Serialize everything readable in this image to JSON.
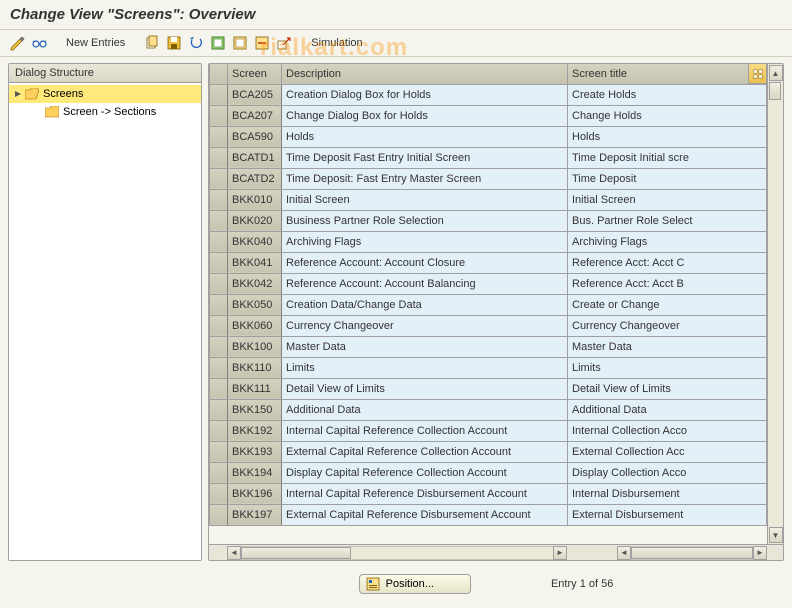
{
  "title": "Change View \"Screens\": Overview",
  "watermark": "rialkart.com",
  "toolbar": {
    "new_entries": "New Entries",
    "simulation": "Simulation"
  },
  "tree": {
    "header": "Dialog Structure",
    "items": [
      {
        "label": "Screens",
        "level": 0,
        "open": true,
        "selected": true
      },
      {
        "label": "Screen -> Sections",
        "level": 1,
        "open": false,
        "closed": true
      }
    ]
  },
  "table": {
    "headers": {
      "screen": "Screen",
      "description": "Description",
      "title": "Screen title"
    },
    "rows": [
      {
        "screen": "BCA205",
        "description": "Creation Dialog Box for Holds",
        "title": "Create Holds"
      },
      {
        "screen": "BCA207",
        "description": "Change Dialog Box for Holds",
        "title": "Change Holds"
      },
      {
        "screen": "BCA590",
        "description": "Holds",
        "title": "Holds"
      },
      {
        "screen": "BCATD1",
        "description": "Time Deposit Fast Entry Initial Screen",
        "title": "Time Deposit Initial scre"
      },
      {
        "screen": "BCATD2",
        "description": "Time Deposit: Fast Entry Master Screen",
        "title": "Time Deposit"
      },
      {
        "screen": "BKK010",
        "description": "Initial Screen",
        "title": "Initial Screen"
      },
      {
        "screen": "BKK020",
        "description": "Business Partner Role Selection",
        "title": "Bus. Partner Role Select"
      },
      {
        "screen": "BKK040",
        "description": "Archiving Flags",
        "title": "Archiving Flags"
      },
      {
        "screen": "BKK041",
        "description": "Reference Account: Account Closure",
        "title": "Reference Acct: Acct C"
      },
      {
        "screen": "BKK042",
        "description": "Reference Account: Account Balancing",
        "title": "Reference Acct: Acct B"
      },
      {
        "screen": "BKK050",
        "description": "Creation Data/Change Data",
        "title": "Create or Change"
      },
      {
        "screen": "BKK060",
        "description": "Currency Changeover",
        "title": "Currency Changeover"
      },
      {
        "screen": "BKK100",
        "description": "Master Data",
        "title": "Master Data"
      },
      {
        "screen": "BKK110",
        "description": "Limits",
        "title": "Limits"
      },
      {
        "screen": "BKK111",
        "description": "Detail View of Limits",
        "title": "Detail View of Limits"
      },
      {
        "screen": "BKK150",
        "description": "Additional Data",
        "title": "Additional Data"
      },
      {
        "screen": "BKK192",
        "description": "Internal Capital Reference Collection Account",
        "title": "Internal Collection Acco"
      },
      {
        "screen": "BKK193",
        "description": "External Capital Reference Collection Account",
        "title": "External Collection Acc"
      },
      {
        "screen": "BKK194",
        "description": "Display Capital Reference Collection Account",
        "title": "Display Collection Acco"
      },
      {
        "screen": "BKK196",
        "description": "Internal Capital Reference Disbursement Account",
        "title": "Internal Disbursement "
      },
      {
        "screen": "BKK197",
        "description": "External Capital Reference Disbursement Account",
        "title": "External Disbursement "
      }
    ]
  },
  "footer": {
    "position": "Position...",
    "entry": "Entry 1 of 56"
  }
}
